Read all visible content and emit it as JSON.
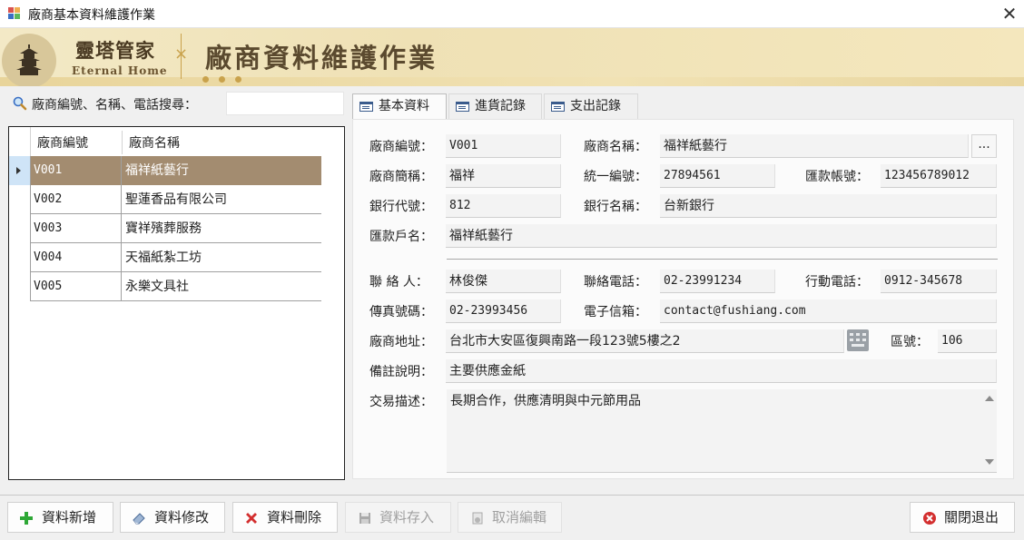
{
  "window": {
    "title": "廠商基本資料維護作業",
    "close_glyph": "✕"
  },
  "banner": {
    "brand_cn": "靈塔管家",
    "brand_en": "Eternal Home",
    "title": "廠商資料維護作業",
    "separator": "×"
  },
  "search": {
    "label": "廠商編號、名稱、電話搜尋：",
    "value": "",
    "icon": "magnifier-icon"
  },
  "grid": {
    "columns": [
      "廠商編號",
      "廠商名稱"
    ],
    "rows": [
      {
        "id": "V001",
        "name": "福祥紙藝行",
        "selected": true
      },
      {
        "id": "V002",
        "name": "聖蓮香品有限公司",
        "selected": false
      },
      {
        "id": "V003",
        "name": "寶祥殯葬服務",
        "selected": false
      },
      {
        "id": "V004",
        "name": "天福紙紮工坊",
        "selected": false
      },
      {
        "id": "V005",
        "name": "永樂文具社",
        "selected": false
      }
    ],
    "selected_color": "#a38c70"
  },
  "tabs": [
    {
      "label": "基本資料",
      "active": true
    },
    {
      "label": "進貨記錄",
      "active": false
    },
    {
      "label": "支出記錄",
      "active": false
    }
  ],
  "form": {
    "vendor_id": {
      "label": "廠商編號：",
      "value": "V001"
    },
    "vendor_name": {
      "label": "廠商名稱：",
      "value": "福祥紙藝行"
    },
    "short_name": {
      "label": "廠商簡稱：",
      "value": "福祥"
    },
    "tax_id": {
      "label": "統一編號：",
      "value": "27894561"
    },
    "remit_account": {
      "label": "匯款帳號：",
      "value": "123456789012"
    },
    "bank_code": {
      "label": "銀行代號：",
      "value": "812"
    },
    "bank_name": {
      "label": "銀行名稱：",
      "value": "台新銀行"
    },
    "remit_holder": {
      "label": "匯款戶名：",
      "value": "福祥紙藝行"
    },
    "contact": {
      "label": "聯 絡 人：",
      "value": "林俊傑"
    },
    "phone": {
      "label": "聯絡電話：",
      "value": "02-23991234"
    },
    "mobile": {
      "label": "行動電話：",
      "value": "0912-345678"
    },
    "fax": {
      "label": "傳真號碼：",
      "value": "02-23993456"
    },
    "email": {
      "label": "電子信箱：",
      "value": "contact@fushiang.com"
    },
    "address": {
      "label": "廠商地址：",
      "value": "台北市大安區復興南路一段123號5樓之2"
    },
    "zip": {
      "label": "區號：",
      "value": "106"
    },
    "remark": {
      "label": "備註說明：",
      "value": "主要供應金紙"
    },
    "transaction": {
      "label": "交易描述：",
      "value": "長期合作，供應清明與中元節用品"
    },
    "ellipsis_label": "..."
  },
  "buttons": {
    "add": {
      "label": "資料新增",
      "icon": "plus-icon",
      "enabled": true
    },
    "edit": {
      "label": "資料修改",
      "icon": "eraser-icon",
      "enabled": true
    },
    "delete": {
      "label": "資料刪除",
      "icon": "delete-x-icon",
      "enabled": true
    },
    "save": {
      "label": "資料存入",
      "icon": "floppy-disk-icon",
      "enabled": false
    },
    "cancel": {
      "label": "取消編輯",
      "icon": "cancel-doc-icon",
      "enabled": false
    },
    "close": {
      "label": "關閉退出",
      "icon": "close-circle-icon",
      "enabled": true
    }
  },
  "colors": {
    "banner_gold": "#c9a24c",
    "add_green": "#2ea836",
    "delete_red": "#d32f2f",
    "close_red": "#d32f2f"
  }
}
